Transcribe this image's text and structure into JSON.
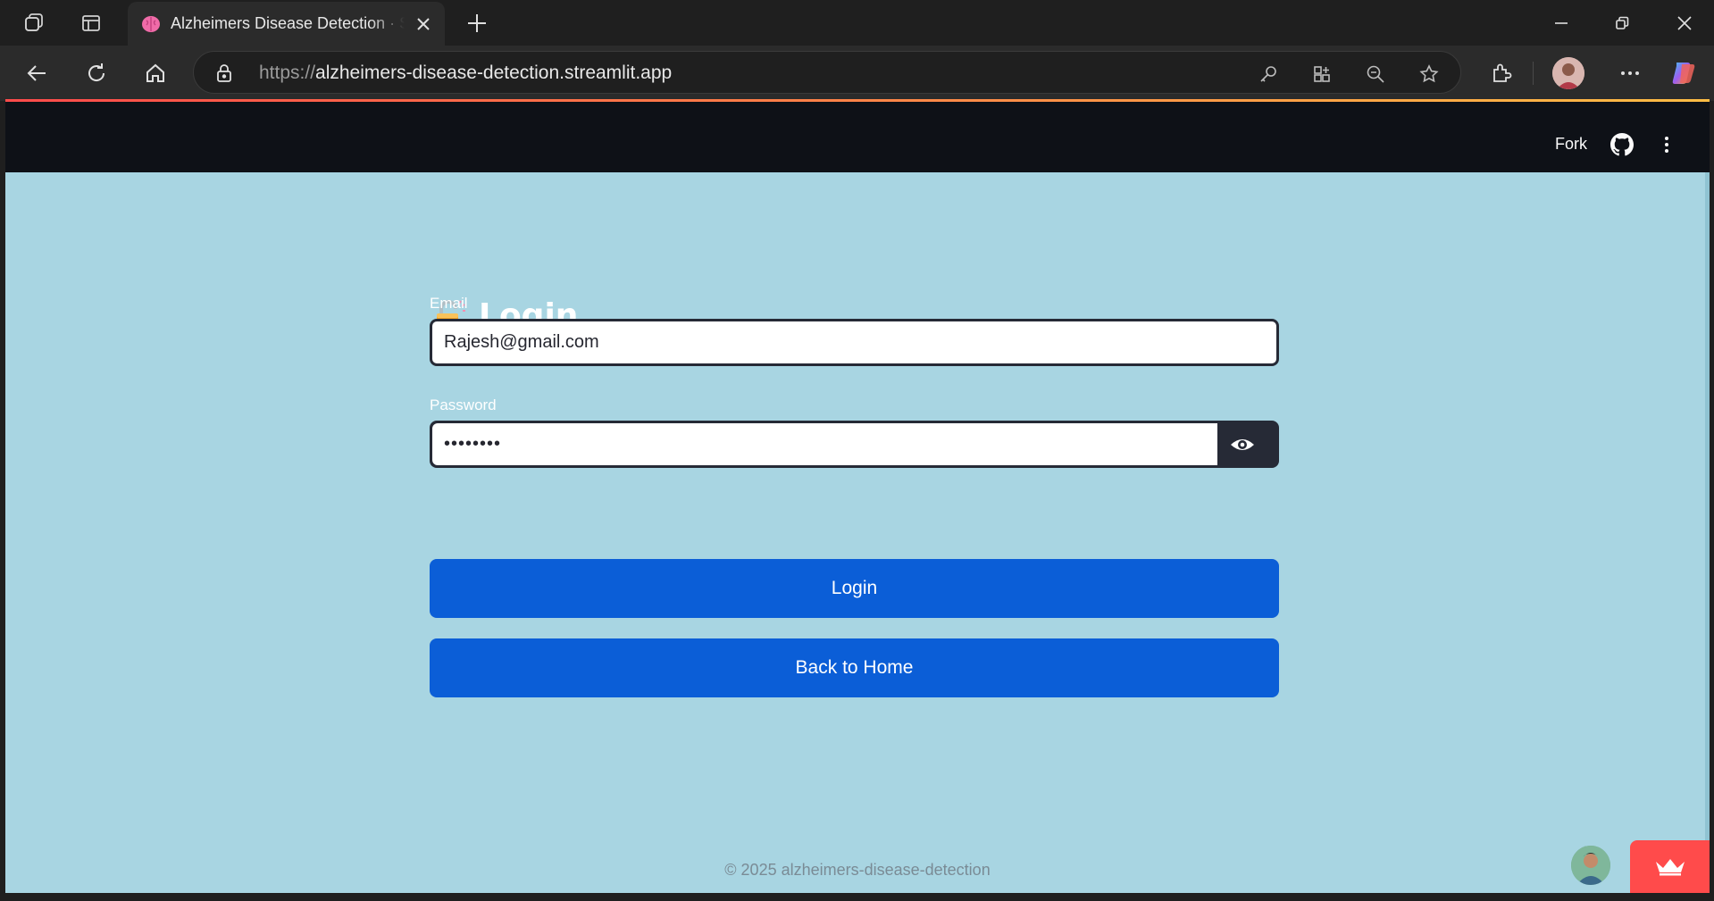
{
  "browser": {
    "tab_title": "Alzheimers Disease Detection · Streamlit",
    "url_protocol": "https://",
    "url_host": "alzheimers-disease-detection.streamlit.app"
  },
  "app_header": {
    "fork_label": "Fork"
  },
  "login": {
    "title": "Login",
    "email_label": "Email",
    "email_value": "Rajesh@gmail.com",
    "password_label": "Password",
    "password_value": "********",
    "login_button": "Login",
    "back_button": "Back to Home"
  },
  "footer": {
    "text": "© 2025 alzheimers-disease-detection"
  },
  "colors": {
    "page_background": "#a8d5e2",
    "header_background": "#0e1117",
    "button_primary": "#0b5ed7",
    "streamlit_red": "#ff4b4b"
  }
}
